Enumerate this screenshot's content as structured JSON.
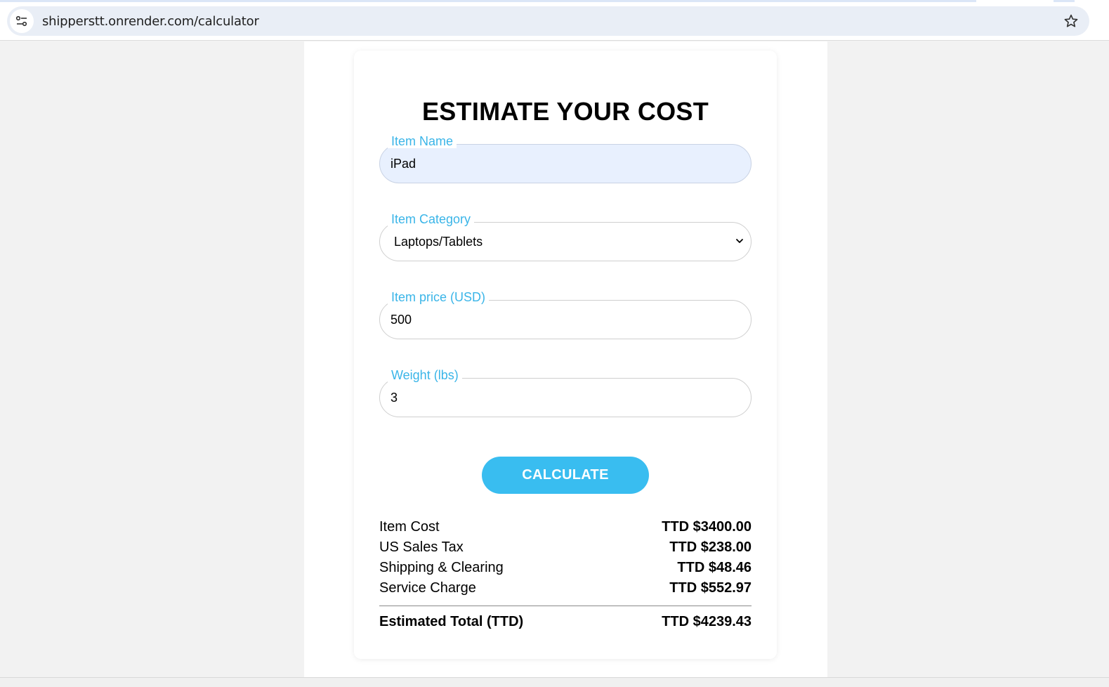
{
  "browser": {
    "url": "shipperstt.onrender.com/calculator",
    "site_info_icon": "tune-icon",
    "bookmark_icon": "star-outline-icon"
  },
  "form": {
    "title": "ESTIMATE YOUR COST",
    "item_name": {
      "label": "Item Name",
      "value": "iPad"
    },
    "item_category": {
      "label": "Item Category",
      "value": "Laptops/Tablets"
    },
    "item_price": {
      "label": "Item price (USD)",
      "value": "500"
    },
    "weight": {
      "label": "Weight (lbs)",
      "value": "3"
    },
    "calculate_label": "CALCULATE"
  },
  "results": {
    "rows": [
      {
        "label": "Item Cost",
        "amount": "TTD $3400.00"
      },
      {
        "label": "US Sales Tax",
        "amount": "TTD $238.00"
      },
      {
        "label": "Shipping & Clearing",
        "amount": "TTD $48.46"
      },
      {
        "label": "Service Charge",
        "amount": "TTD $552.97"
      }
    ],
    "total": {
      "label": "Estimated Total (TTD)",
      "amount": "TTD $4239.43"
    }
  },
  "colors": {
    "accent": "#39bdf0",
    "label": "#3ab5e8",
    "autofill_bg": "#e8f0fe"
  }
}
